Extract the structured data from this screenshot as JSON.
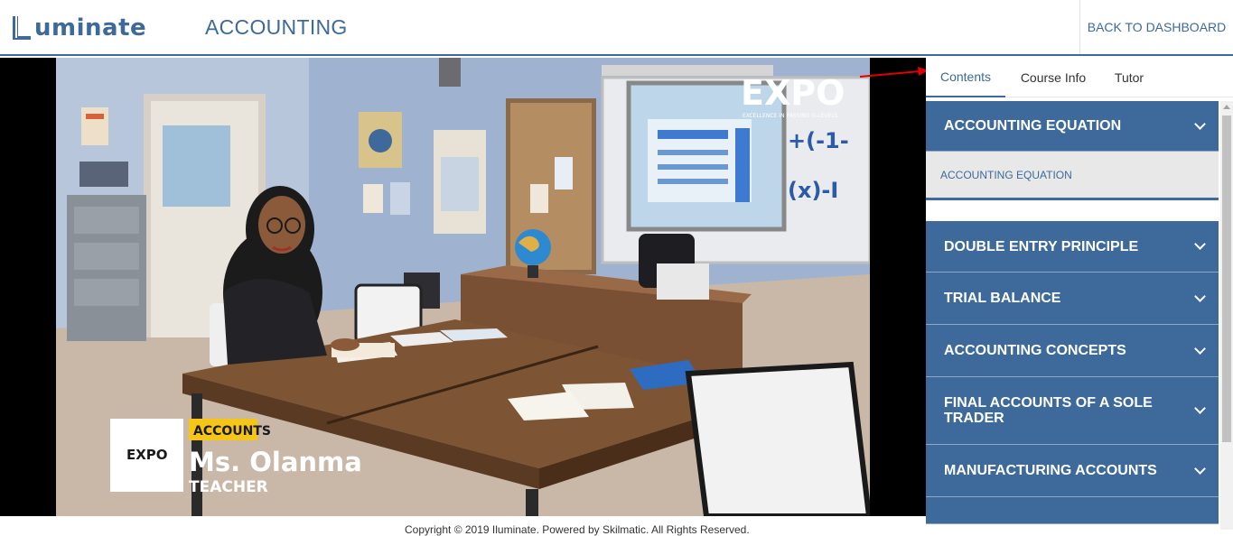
{
  "header": {
    "logo_text": "uminate",
    "page_title": "ACCOUNTING",
    "back_link": "BACK TO DASHBOARD"
  },
  "video": {
    "expo_logo": "EXPO",
    "expo_tagline": "EXCELLENCE IN PASSING O-LEVELS",
    "board_text_1": "+(-1-",
    "board_text_2": "(x)-I",
    "lower_third": {
      "tag": "ACCOUNTS",
      "name": "Ms. Olanma",
      "role": "TEACHER",
      "badge_logo": "EXPO"
    }
  },
  "sidebar": {
    "tabs": [
      {
        "label": "Contents",
        "active": true
      },
      {
        "label": "Course Info",
        "active": false
      },
      {
        "label": "Tutor",
        "active": false
      }
    ],
    "sections": [
      {
        "label": "ACCOUNTING EQUATION",
        "expanded": true,
        "items": [
          "ACCOUNTING EQUATION"
        ]
      },
      {
        "label": "DOUBLE ENTRY PRINCIPLE",
        "expanded": false
      },
      {
        "label": "TRIAL BALANCE",
        "expanded": false
      },
      {
        "label": "ACCOUNTING CONCEPTS",
        "expanded": false
      },
      {
        "label": "FINAL ACCOUNTS OF A SOLE TRADER",
        "expanded": false
      },
      {
        "label": "MANUFACTURING ACCOUNTS",
        "expanded": false
      }
    ]
  },
  "colors": {
    "brand": "#3d6a9a",
    "accent_yellow": "#f5c518",
    "annotation_arrow": "#e00000"
  },
  "footer": {
    "copyright": "Copyright © 2019 Iluminate. Powered by Skilmatic. All Rights Reserved."
  }
}
